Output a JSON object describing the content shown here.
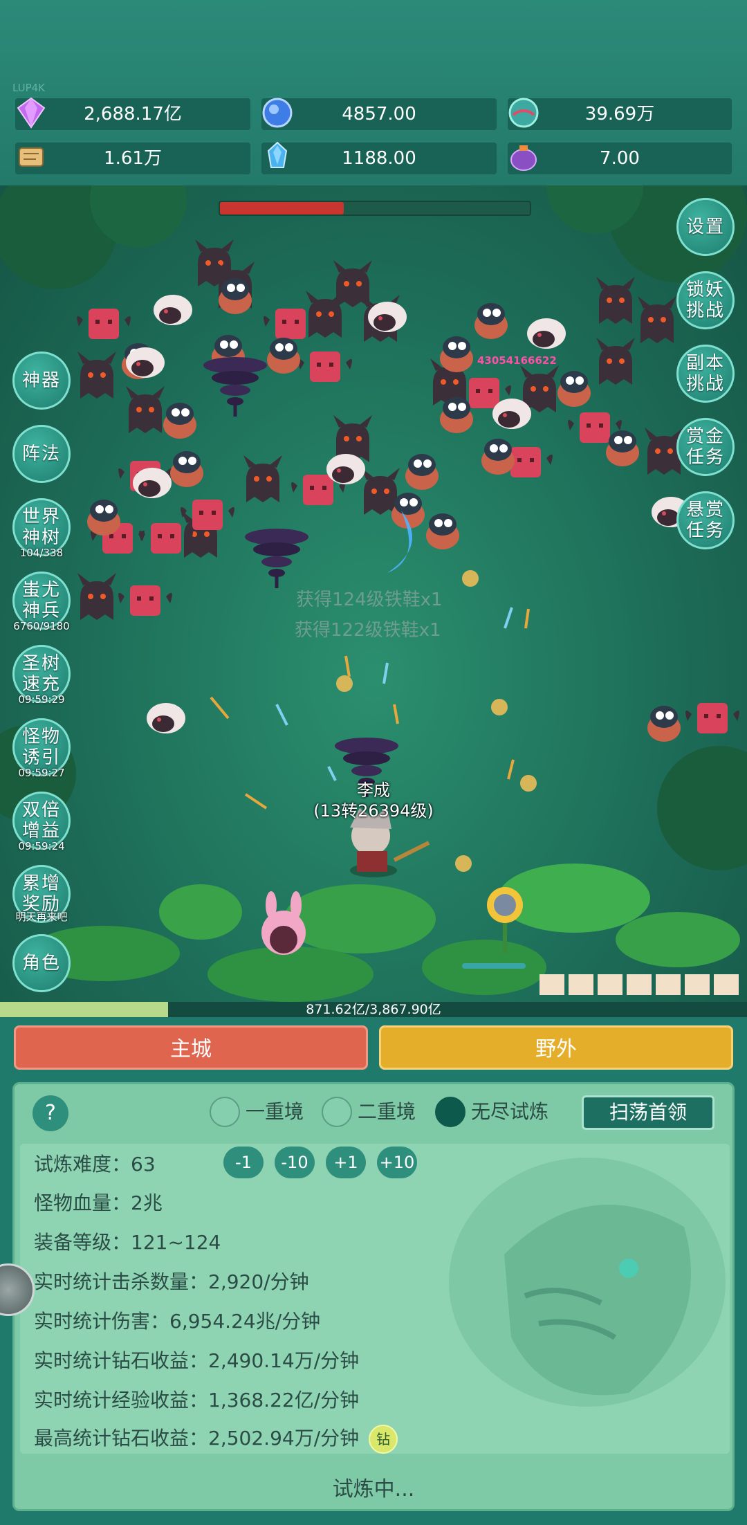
{
  "tag": "LUP4K",
  "resources": [
    {
      "icon": "diamond-icon",
      "value": "2,688.17亿"
    },
    {
      "icon": "blue-crystal-icon",
      "value": "4857.00"
    },
    {
      "icon": "green-orb-icon",
      "value": "39.69万"
    },
    {
      "icon": "scroll-icon",
      "value": "1.61万"
    },
    {
      "icon": "ice-shard-icon",
      "value": "1188.00"
    },
    {
      "icon": "purple-pouch-icon",
      "value": "7.00"
    }
  ],
  "boss_hp": 0.4,
  "left_menu": [
    {
      "label": "神器",
      "sub": ""
    },
    {
      "label": "阵法",
      "sub": ""
    },
    {
      "label": "世界神树",
      "sub": "104/338"
    },
    {
      "label": "蚩尤神兵",
      "sub": "6760/9180"
    },
    {
      "label": "圣树速充",
      "sub": "09:59:29"
    },
    {
      "label": "怪物诱引",
      "sub": "09:59:27"
    },
    {
      "label": "双倍增益",
      "sub": "09:59:24"
    },
    {
      "label": "累增奖励",
      "sub": "明天再来吧"
    },
    {
      "label": "角色",
      "sub": ""
    }
  ],
  "right_menu": [
    {
      "label": "设置"
    },
    {
      "label": "锁妖挑战"
    },
    {
      "label": "副本挑战"
    },
    {
      "label": "赏金任务"
    },
    {
      "label": "悬赏任务"
    }
  ],
  "damage_number": "43054166622",
  "loot_messages": [
    "获得124级铁鞋x1",
    "获得122级铁鞋x1"
  ],
  "player": {
    "name": "李成",
    "level": "(13转26394级)"
  },
  "xp": {
    "text": "871.62亿/3,867.90亿",
    "fraction": 0.225
  },
  "buttons": {
    "main_city": "主城",
    "wild": "野外"
  },
  "panel": {
    "help": "?",
    "modes": [
      {
        "label": "一重境",
        "selected": false
      },
      {
        "label": "二重境",
        "selected": false
      },
      {
        "label": "无尽试炼",
        "selected": true
      }
    ],
    "sweep": "扫荡首领",
    "difficulty_label": "试炼难度：",
    "difficulty_value": "63",
    "adjust": [
      "-1",
      "-10",
      "+1",
      "+10"
    ],
    "stats": [
      {
        "label": "怪物血量：",
        "value": "2兆"
      },
      {
        "label": "装备等级：",
        "value": "121~124"
      },
      {
        "label": "实时统计击杀数量：",
        "value": "2,920/分钟"
      },
      {
        "label": "实时统计伤害：",
        "value": "6,954.24兆/分钟"
      },
      {
        "label": "实时统计钻石收益：",
        "value": "2,490.14万/分钟"
      },
      {
        "label": "实时统计经验收益：",
        "value": "1,368.22亿/分钟"
      },
      {
        "label": "最高统计钻石收益：",
        "value": "2,502.94万/分钟"
      }
    ],
    "badge": "钻",
    "status": "试炼中..."
  }
}
